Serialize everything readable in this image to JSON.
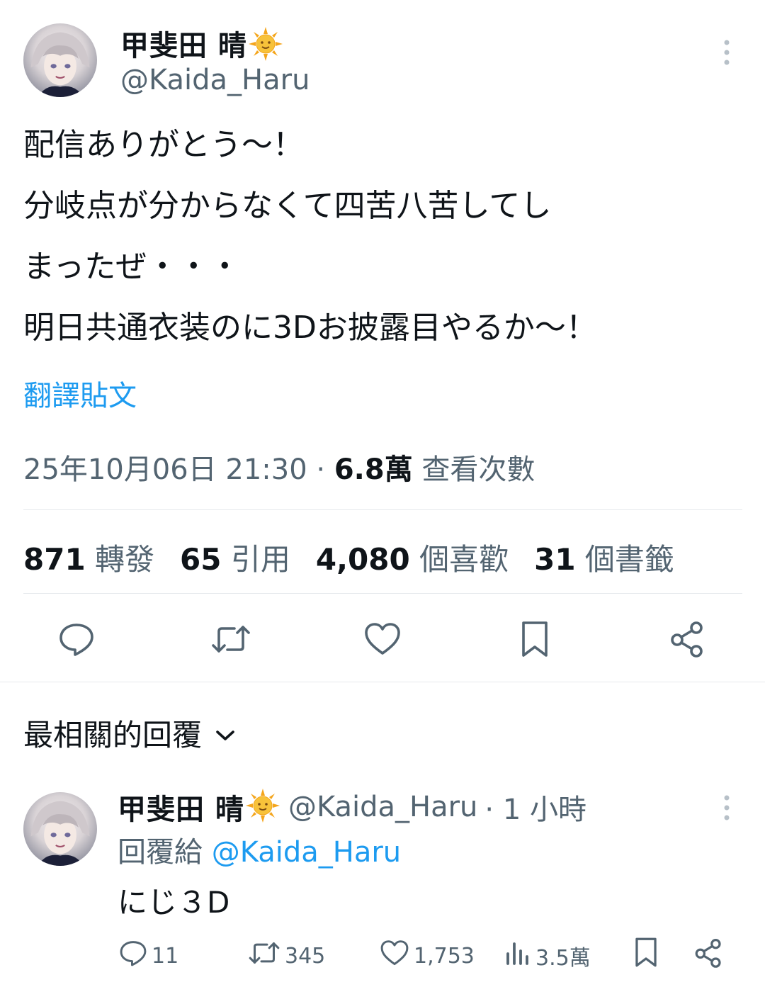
{
  "tweet": {
    "author_name": "甲斐田 晴",
    "author_handle": "@Kaida_Haru",
    "text_lines": [
      "配信ありがとう〜！",
      "分岐点が分からなくて四苦八苦してし",
      "まったぜ・・・",
      "明日共通衣装のに3Dお披露目やるか〜！"
    ],
    "translate_label": "翻譯貼文",
    "timestamp": "25年10月06日 21:30",
    "separator": " · ",
    "views_count": "6.8萬",
    "views_label": " 查看次數",
    "stats": [
      {
        "count": "871",
        "label": "轉發"
      },
      {
        "count": "65",
        "label": "引用"
      },
      {
        "count": "4,080",
        "label": "個喜歡"
      },
      {
        "count": "31",
        "label": "個書籤"
      }
    ],
    "actions": [
      {
        "icon": "reply-icon"
      },
      {
        "icon": "retweet-icon"
      },
      {
        "icon": "like-icon"
      },
      {
        "icon": "bookmark-icon"
      },
      {
        "icon": "share-icon"
      }
    ]
  },
  "replies_header": "最相關的回覆",
  "reply": {
    "author_name": "甲斐田 晴",
    "author_handle": "@Kaida_Haru",
    "time": "· 1 小時",
    "replying_to_label": "回覆給",
    "replying_to_handle": "@Kaida_Haru",
    "text": "にじ３D",
    "reply_count": "11",
    "retweet_count": "345",
    "like_count": "1,753",
    "view_count": "3.5萬"
  },
  "colors": {
    "link": "#1d9bf0",
    "secondary_text": "#536471",
    "divider": "#e6e9ec",
    "sun": "#f4a51c"
  }
}
